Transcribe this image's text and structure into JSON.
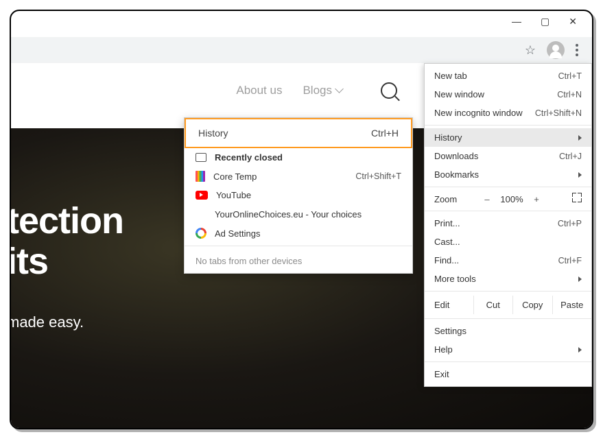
{
  "window_controls": {
    "minimize": "—",
    "maximize": "▢",
    "close": "✕"
  },
  "page_nav": {
    "about": "About us",
    "blogs": "Blogs"
  },
  "hero": {
    "title_line1": "tection",
    "title_line2": "its",
    "tagline": "made easy."
  },
  "chrome_menu": {
    "new_tab": {
      "label": "New tab",
      "shortcut": "Ctrl+T"
    },
    "new_window": {
      "label": "New window",
      "shortcut": "Ctrl+N"
    },
    "new_incognito": {
      "label": "New incognito window",
      "shortcut": "Ctrl+Shift+N"
    },
    "history": {
      "label": "History"
    },
    "downloads": {
      "label": "Downloads",
      "shortcut": "Ctrl+J"
    },
    "bookmarks": {
      "label": "Bookmarks"
    },
    "zoom": {
      "label": "Zoom",
      "minus": "–",
      "value": "100%",
      "plus": "+"
    },
    "print": {
      "label": "Print...",
      "shortcut": "Ctrl+P"
    },
    "cast": {
      "label": "Cast..."
    },
    "find": {
      "label": "Find...",
      "shortcut": "Ctrl+F"
    },
    "more_tools": {
      "label": "More tools"
    },
    "edit": {
      "label": "Edit",
      "cut": "Cut",
      "copy": "Copy",
      "paste": "Paste"
    },
    "settings": {
      "label": "Settings"
    },
    "help": {
      "label": "Help"
    },
    "exit": {
      "label": "Exit"
    }
  },
  "history_submenu": {
    "header": {
      "label": "History",
      "shortcut": "Ctrl+H"
    },
    "recently_closed": "Recently closed",
    "items": [
      {
        "label": "Core Temp",
        "shortcut": "Ctrl+Shift+T",
        "icon": "ct"
      },
      {
        "label": "YouTube",
        "shortcut": "",
        "icon": "yt"
      },
      {
        "label": "YourOnlineChoices.eu - Your choices",
        "shortcut": "",
        "icon": "blank"
      },
      {
        "label": "Ad Settings",
        "shortcut": "",
        "icon": "g"
      }
    ],
    "footer": "No tabs from other devices"
  }
}
